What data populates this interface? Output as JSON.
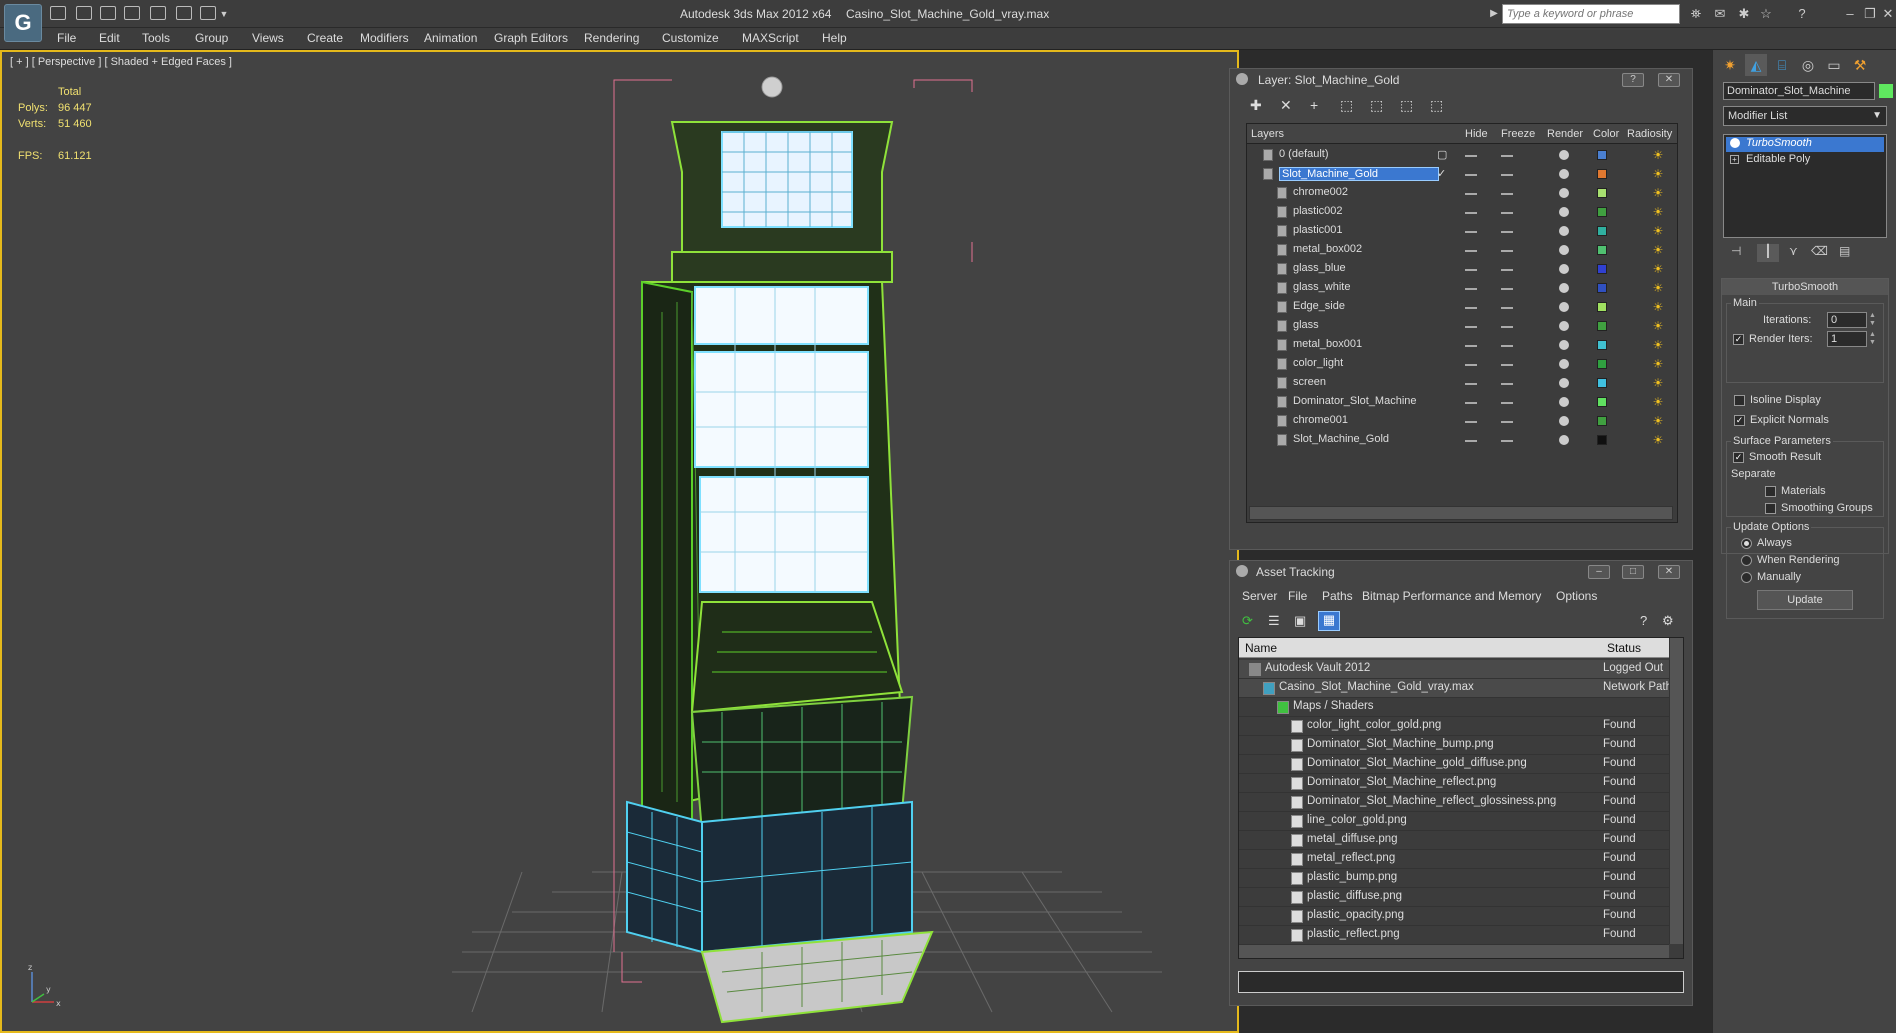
{
  "app": {
    "title": "Autodesk 3ds Max  2012 x64",
    "filename": "Casino_Slot_Machine_Gold_vray.max",
    "logo": "3ds-max-logo",
    "search_placeholder": "Type a keyword or phrase"
  },
  "menu": [
    "File",
    "Edit",
    "Tools",
    "Group",
    "Views",
    "Create",
    "Modifiers",
    "Animation",
    "Graph Editors",
    "Rendering",
    "Customize",
    "MAXScript",
    "Help"
  ],
  "viewport": {
    "label": "[ + ] [ Perspective ] [ Shaded + Edged Faces ]",
    "stats": {
      "header": "Total",
      "polys_label": "Polys:",
      "polys": "96 447",
      "verts_label": "Verts:",
      "verts": "51 460",
      "fps_label": "FPS:",
      "fps": "61.121"
    },
    "axis": {
      "x": "x",
      "y": "y",
      "z": "z"
    }
  },
  "layer_panel": {
    "title": "Layer: Slot_Machine_Gold",
    "columns": [
      "Layers",
      "Hide",
      "Freeze",
      "Render",
      "Color",
      "Radiosity"
    ],
    "rows": [
      {
        "name": "0 (default)",
        "color": "#4a7fd0",
        "level": 0,
        "selected": false
      },
      {
        "name": "Slot_Machine_Gold",
        "color": "#e07830",
        "level": 0,
        "selected": true
      },
      {
        "name": "chrome002",
        "color": "#a8e070",
        "level": 1,
        "selected": false
      },
      {
        "name": "plastic002",
        "color": "#40a040",
        "level": 1,
        "selected": false
      },
      {
        "name": "plastic001",
        "color": "#30b0a0",
        "level": 1,
        "selected": false
      },
      {
        "name": "metal_box002",
        "color": "#50c070",
        "level": 1,
        "selected": false
      },
      {
        "name": "glass_blue",
        "color": "#3040d0",
        "level": 1,
        "selected": false
      },
      {
        "name": "glass_white",
        "color": "#3050c0",
        "level": 1,
        "selected": false
      },
      {
        "name": "Edge_side",
        "color": "#a0e060",
        "level": 1,
        "selected": false
      },
      {
        "name": "glass",
        "color": "#40a040",
        "level": 1,
        "selected": false
      },
      {
        "name": "metal_box001",
        "color": "#40c0d0",
        "level": 1,
        "selected": false
      },
      {
        "name": "color_light",
        "color": "#30a040",
        "level": 1,
        "selected": false
      },
      {
        "name": "screen",
        "color": "#40c0e0",
        "level": 1,
        "selected": false
      },
      {
        "name": "Dominator_Slot_Machine",
        "color": "#60e060",
        "level": 1,
        "selected": false
      },
      {
        "name": "chrome001",
        "color": "#40a040",
        "level": 1,
        "selected": false
      },
      {
        "name": "Slot_Machine_Gold",
        "color": "#101010",
        "level": 1,
        "selected": false
      }
    ]
  },
  "asset_panel": {
    "title": "Asset Tracking",
    "menu": [
      "Server",
      "File",
      "Paths",
      "Bitmap Performance and Memory",
      "Options"
    ],
    "columns": [
      "Name",
      "Status"
    ],
    "rows": [
      {
        "name": "Autodesk Vault 2012",
        "status": "Logged Out",
        "level": 0
      },
      {
        "name": "Casino_Slot_Machine_Gold_vray.max",
        "status": "Network Path",
        "level": 1
      },
      {
        "name": "Maps / Shaders",
        "status": "",
        "level": 2
      },
      {
        "name": "color_light_color_gold.png",
        "status": "Found",
        "level": 3
      },
      {
        "name": "Dominator_Slot_Machine_bump.png",
        "status": "Found",
        "level": 3
      },
      {
        "name": "Dominator_Slot_Machine_gold_diffuse.png",
        "status": "Found",
        "level": 3
      },
      {
        "name": "Dominator_Slot_Machine_reflect.png",
        "status": "Found",
        "level": 3
      },
      {
        "name": "Dominator_Slot_Machine_reflect_glossiness.png",
        "status": "Found",
        "level": 3
      },
      {
        "name": "line_color_gold.png",
        "status": "Found",
        "level": 3
      },
      {
        "name": "metal_diffuse.png",
        "status": "Found",
        "level": 3
      },
      {
        "name": "metal_reflect.png",
        "status": "Found",
        "level": 3
      },
      {
        "name": "plastic_bump.png",
        "status": "Found",
        "level": 3
      },
      {
        "name": "plastic_diffuse.png",
        "status": "Found",
        "level": 3
      },
      {
        "name": "plastic_opacity.png",
        "status": "Found",
        "level": 3
      },
      {
        "name": "plastic_reflect.png",
        "status": "Found",
        "level": 3
      }
    ]
  },
  "command_panel": {
    "object_name": "Dominator_Slot_Machine",
    "object_color": "#5fe85f",
    "modifier_list": "Modifier List",
    "stack": [
      "TurboSmooth",
      "Editable Poly"
    ],
    "turbosmooth": {
      "title": "TurboSmooth",
      "main_label": "Main",
      "iterations_label": "Iterations:",
      "iterations": "0",
      "render_iters_label": "Render Iters:",
      "render_iters": "1",
      "isoline_label": "Isoline Display",
      "explicit_normals_label": "Explicit Normals",
      "surface_label": "Surface Parameters",
      "smooth_result_label": "Smooth Result",
      "separate_label": "Separate",
      "materials_label": "Materials",
      "smoothing_groups_label": "Smoothing Groups",
      "update_options_label": "Update Options",
      "always_label": "Always",
      "when_rendering_label": "When Rendering",
      "manually_label": "Manually",
      "update_button": "Update"
    }
  }
}
